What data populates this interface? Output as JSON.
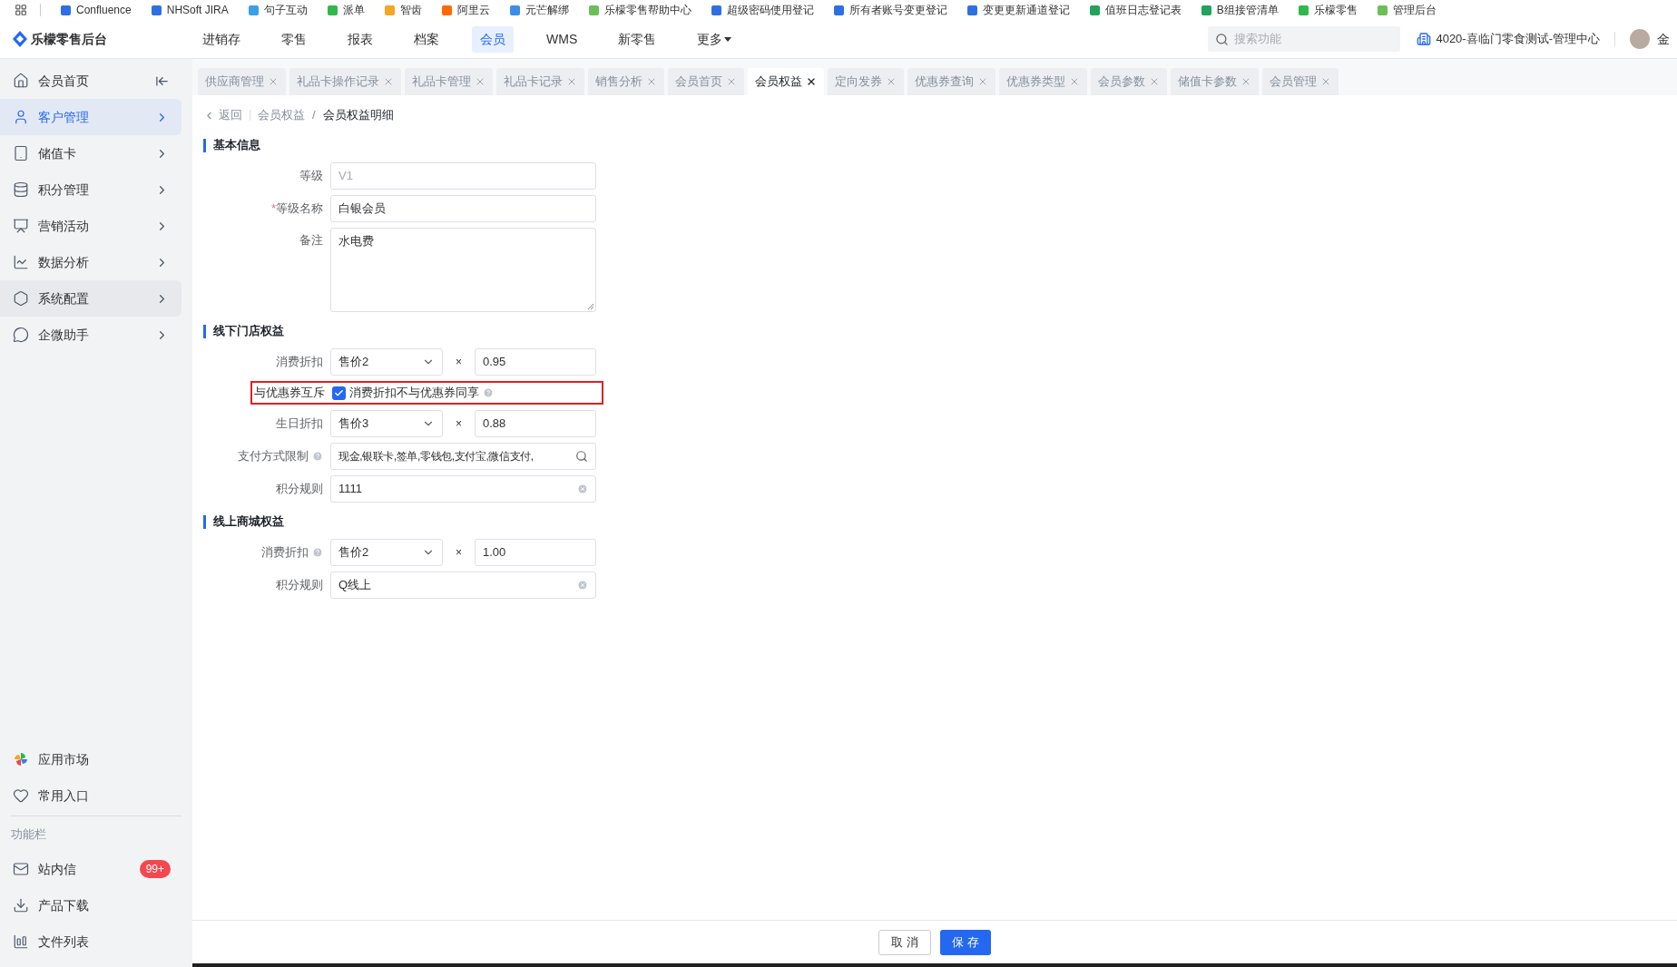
{
  "bookmarks": [
    {
      "label": "Confluence",
      "color": "#2f6fe4"
    },
    {
      "label": "NHSoft JIRA",
      "color": "#2f6fe4"
    },
    {
      "label": "句子互动",
      "color": "#3aa0e6"
    },
    {
      "label": "派单",
      "color": "#2fb84b"
    },
    {
      "label": "智齿",
      "color": "#f5a623"
    },
    {
      "label": "阿里云",
      "color": "#ff6a00"
    },
    {
      "label": "元芒解绑",
      "color": "#3a8ee6"
    },
    {
      "label": "乐檬零售帮助中心",
      "color": "#6bbf59"
    },
    {
      "label": "超级密码使用登记",
      "color": "#2f6fe4"
    },
    {
      "label": "所有者账号变更登记",
      "color": "#2f6fe4"
    },
    {
      "label": "变更更新通道登记",
      "color": "#2f6fe4"
    },
    {
      "label": "值班日志登记表",
      "color": "#21a35b"
    },
    {
      "label": "B组接管清单",
      "color": "#21a35b"
    },
    {
      "label": "乐檬零售",
      "color": "#2fb84b"
    },
    {
      "label": "管理后台",
      "color": "#6bbf59"
    }
  ],
  "header": {
    "app_name": "乐檬零售后台",
    "nav": [
      {
        "label": "进销存",
        "selected": false
      },
      {
        "label": "零售",
        "selected": false
      },
      {
        "label": "报表",
        "selected": false
      },
      {
        "label": "档案",
        "selected": false
      },
      {
        "label": "会员",
        "selected": true
      },
      {
        "label": "WMS",
        "selected": false
      },
      {
        "label": "新零售",
        "selected": false
      },
      {
        "label": "更多",
        "selected": false,
        "dropdown": true
      }
    ],
    "search": {
      "placeholder": "搜索功能"
    },
    "store": "4020-喜临门零食测试-管理中心",
    "user": "金"
  },
  "sidebar": {
    "items": [
      {
        "label": "会员首页",
        "selected": false,
        "collapse": true
      },
      {
        "label": "客户管理",
        "selected": true
      },
      {
        "label": "储值卡",
        "selected": false
      },
      {
        "label": "积分管理",
        "selected": false
      },
      {
        "label": "营销活动",
        "selected": false
      },
      {
        "label": "数据分析",
        "selected": false
      },
      {
        "label": "系统配置",
        "selected": false,
        "hovered": true
      },
      {
        "label": "企微助手",
        "selected": false
      }
    ],
    "bottom_items": [
      {
        "label": "应用市场"
      },
      {
        "label": "常用入口"
      }
    ],
    "section_title": "功能栏",
    "tools": [
      {
        "label": "站内信",
        "badge": "99+"
      },
      {
        "label": "产品下载"
      },
      {
        "label": "文件列表"
      }
    ]
  },
  "tabs": [
    {
      "label": "供应商管理",
      "selected": false
    },
    {
      "label": "礼品卡操作记录",
      "selected": false
    },
    {
      "label": "礼品卡管理",
      "selected": false
    },
    {
      "label": "礼品卡记录",
      "selected": false
    },
    {
      "label": "销售分析",
      "selected": false
    },
    {
      "label": "会员首页",
      "selected": false
    },
    {
      "label": "会员权益",
      "selected": true
    },
    {
      "label": "定向发券",
      "selected": false
    },
    {
      "label": "优惠券查询",
      "selected": false
    },
    {
      "label": "优惠券类型",
      "selected": false
    },
    {
      "label": "会员参数",
      "selected": false
    },
    {
      "label": "储值卡参数",
      "selected": false
    },
    {
      "label": "会员管理",
      "selected": false
    }
  ],
  "breadcrumb": {
    "back": "返回",
    "separator": "/",
    "items": [
      "会员权益",
      "会员权益明细"
    ]
  },
  "sections": [
    {
      "title": "基本信息",
      "fields": [
        {
          "kind": "input",
          "label": "等级",
          "value": "V1",
          "disabled": true
        },
        {
          "kind": "input",
          "label": "等级名称",
          "value": "白银会员",
          "required_mark": "*"
        },
        {
          "kind": "textarea",
          "label": "备注",
          "value": "水电费"
        }
      ]
    },
    {
      "title": "线下门店权益",
      "fields": [
        {
          "kind": "select_factor",
          "label": "消费折扣",
          "select": "售价2",
          "operator": "×",
          "value": "0.95"
        },
        {
          "kind": "checkbox",
          "label": "与优惠券互斥",
          "text": "消费折扣不与优惠券同享",
          "checked": true,
          "help": true,
          "highlighted": true
        },
        {
          "kind": "select_factor",
          "label": "生日折扣",
          "select": "售价3",
          "operator": "×",
          "value": "0.88"
        },
        {
          "kind": "search",
          "label": "支付方式限制",
          "value": "现金,银联卡,签单,零钱包,支付宝,微信支付,",
          "help": true
        },
        {
          "kind": "clearable",
          "label": "积分规则",
          "value": "1111"
        }
      ]
    },
    {
      "title": "线上商城权益",
      "fields": [
        {
          "kind": "select_factor",
          "label": "消费折扣",
          "select": "售价2",
          "operator": "×",
          "value": "1.00",
          "help": true
        },
        {
          "kind": "clearable",
          "label": "积分规则",
          "value": "Q线上"
        }
      ]
    }
  ],
  "footer": {
    "buttons": [
      {
        "label": "取 消",
        "primary": false
      },
      {
        "label": "保 存",
        "primary": true
      }
    ]
  }
}
